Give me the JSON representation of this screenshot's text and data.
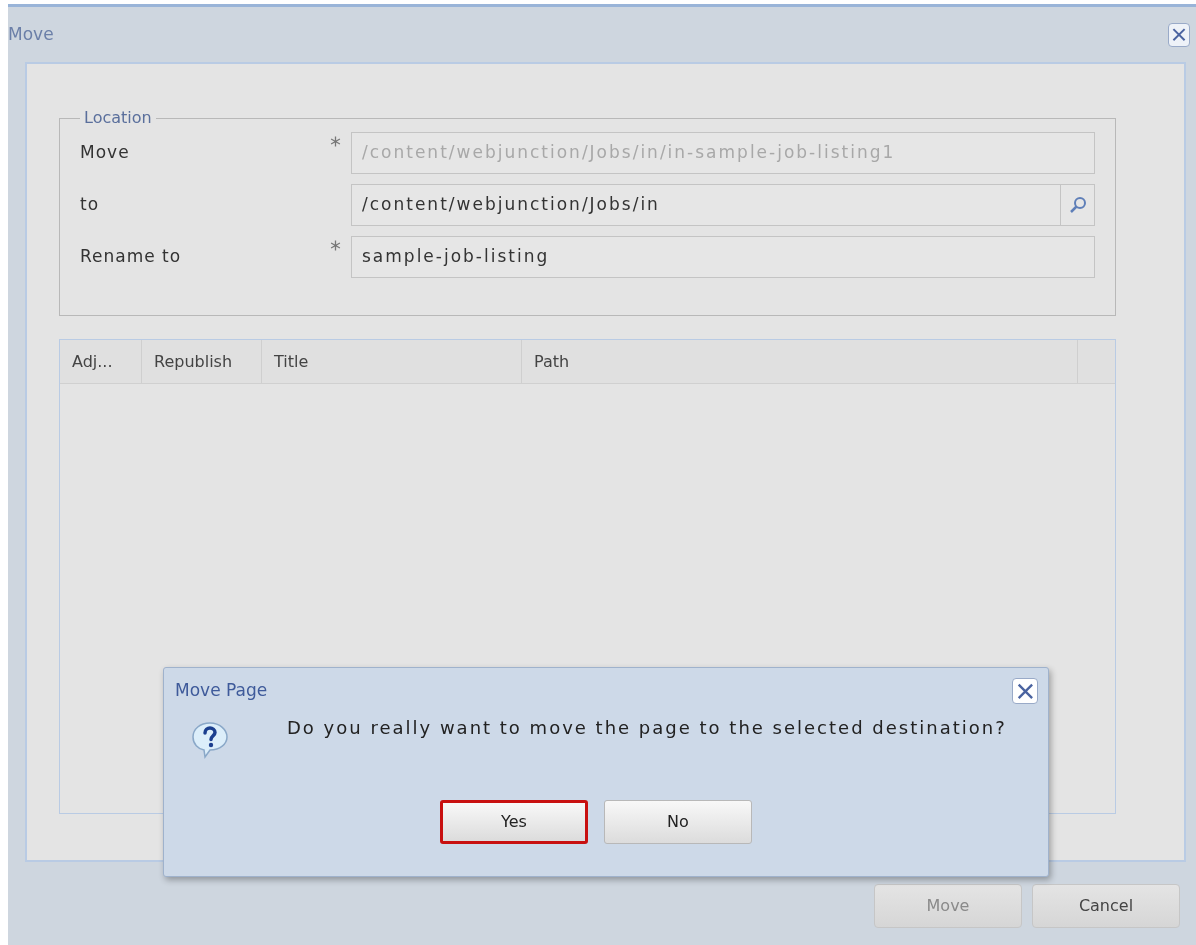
{
  "window": {
    "title": "Move"
  },
  "location": {
    "legend": "Location",
    "fields": [
      {
        "label": "Move",
        "required": true,
        "value": "/content/webjunction/Jobs/in/in-sample-job-listing1",
        "disabled": true,
        "kind": "text"
      },
      {
        "label": "to",
        "required": false,
        "value": "/content/webjunction/Jobs/in",
        "disabled": false,
        "kind": "browse"
      },
      {
        "label": "Rename to",
        "required": true,
        "value": "sample-job-listing",
        "disabled": false,
        "kind": "text"
      }
    ]
  },
  "table": {
    "columns": [
      "Adj...",
      "Republish",
      "Title",
      "Path"
    ]
  },
  "footer_buttons": [
    {
      "label": "Move",
      "disabled": true
    },
    {
      "label": "Cancel",
      "disabled": false
    }
  ],
  "dialog": {
    "title": "Move Page",
    "message": "Do you really want to move the page to the selected destination?",
    "buttons": [
      {
        "label": "Yes",
        "focused": true
      },
      {
        "label": "No",
        "focused": false
      }
    ]
  }
}
